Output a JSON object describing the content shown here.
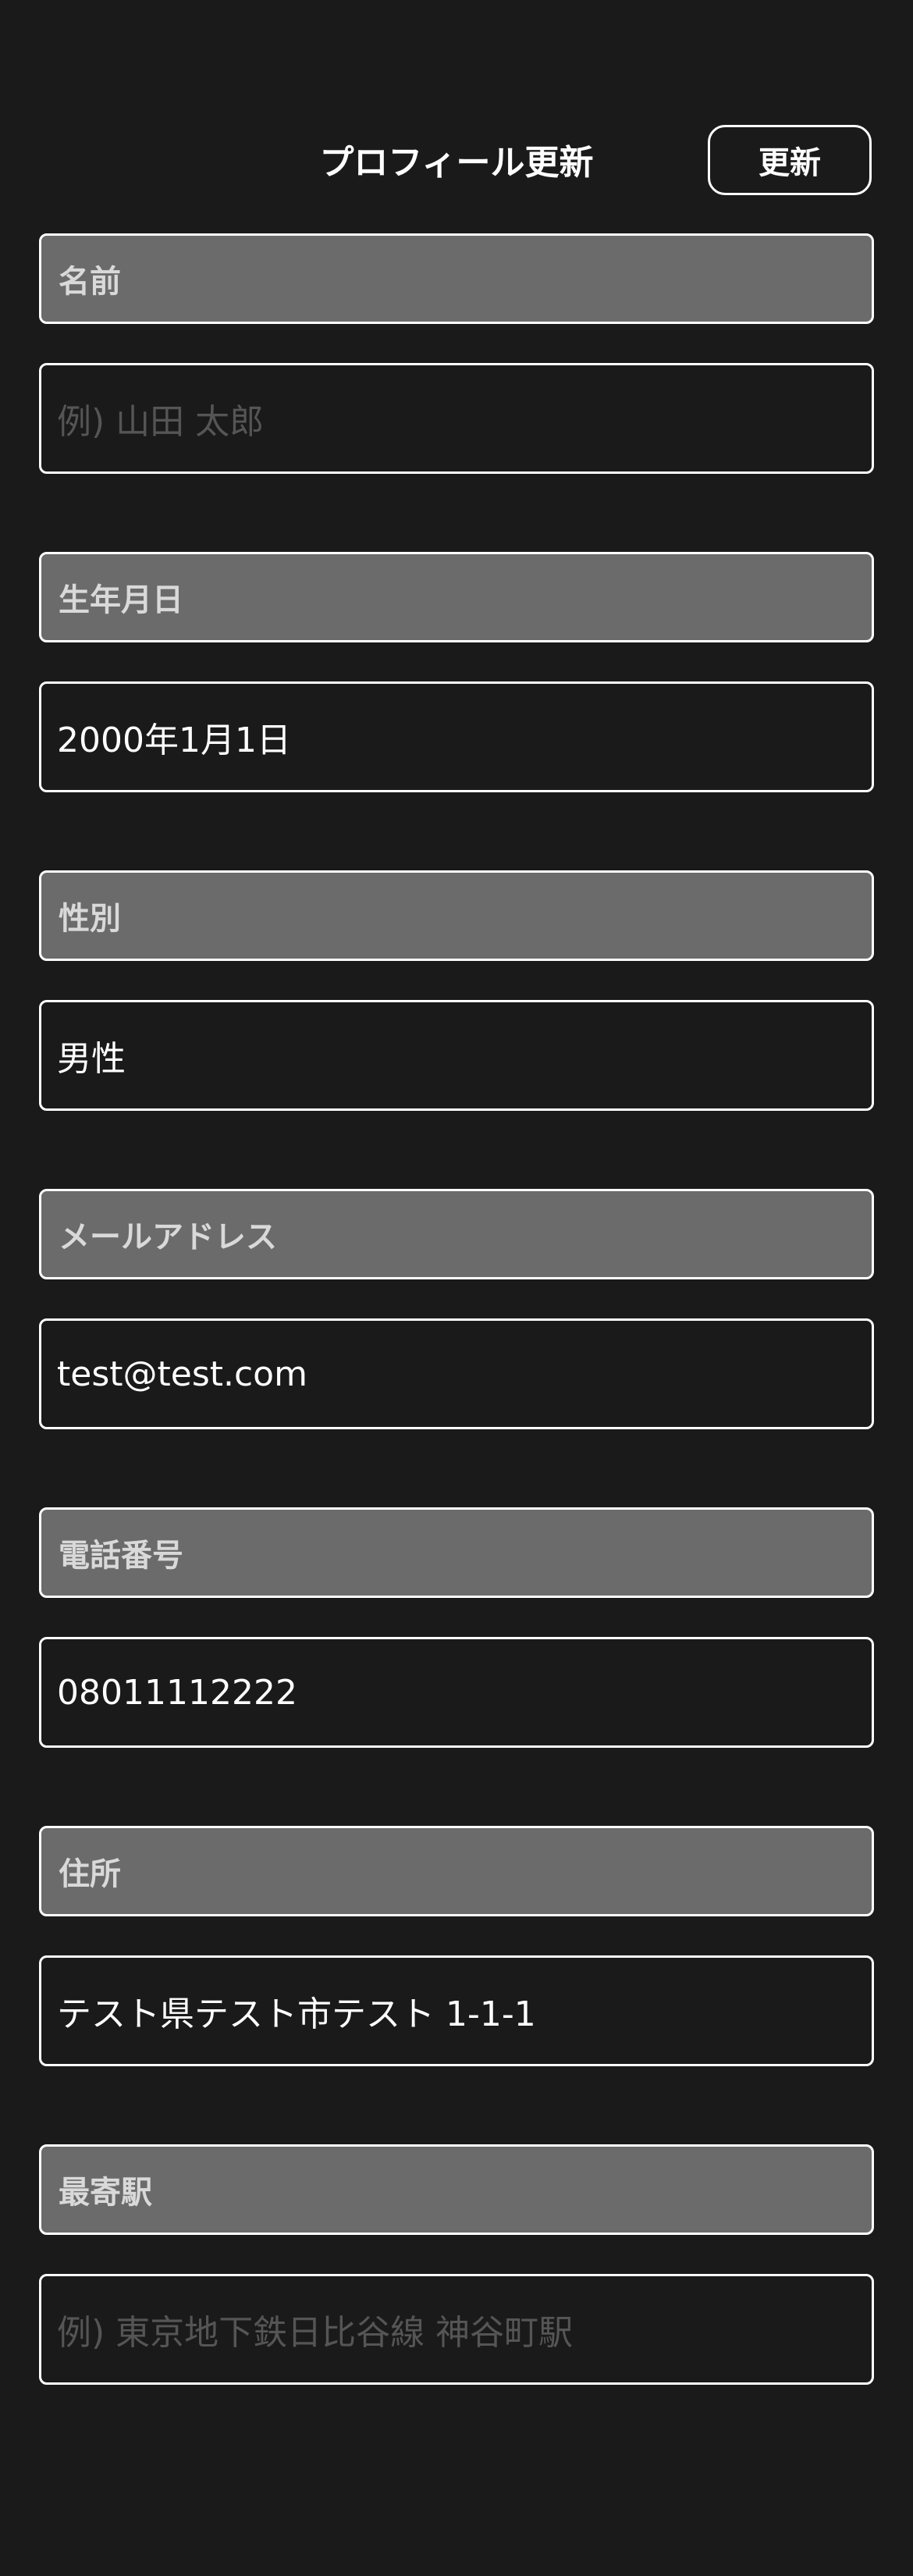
{
  "header": {
    "title": "プロフィール更新",
    "update_label": "更新"
  },
  "fields": [
    {
      "label": "名前",
      "value": "",
      "placeholder": "例) 山田 太郎"
    },
    {
      "label": "生年月日",
      "value": "2000年1月1日",
      "placeholder": ""
    },
    {
      "label": "性別",
      "value": "男性",
      "placeholder": ""
    },
    {
      "label": "メールアドレス",
      "value": "test@test.com",
      "placeholder": ""
    },
    {
      "label": "電話番号",
      "value": "08011112222",
      "placeholder": ""
    },
    {
      "label": "住所",
      "value": "テスト県テスト市テスト 1-1-1",
      "placeholder": ""
    },
    {
      "label": "最寄駅",
      "value": "",
      "placeholder": "例) 東京地下鉄日比谷線 神谷町駅"
    }
  ]
}
